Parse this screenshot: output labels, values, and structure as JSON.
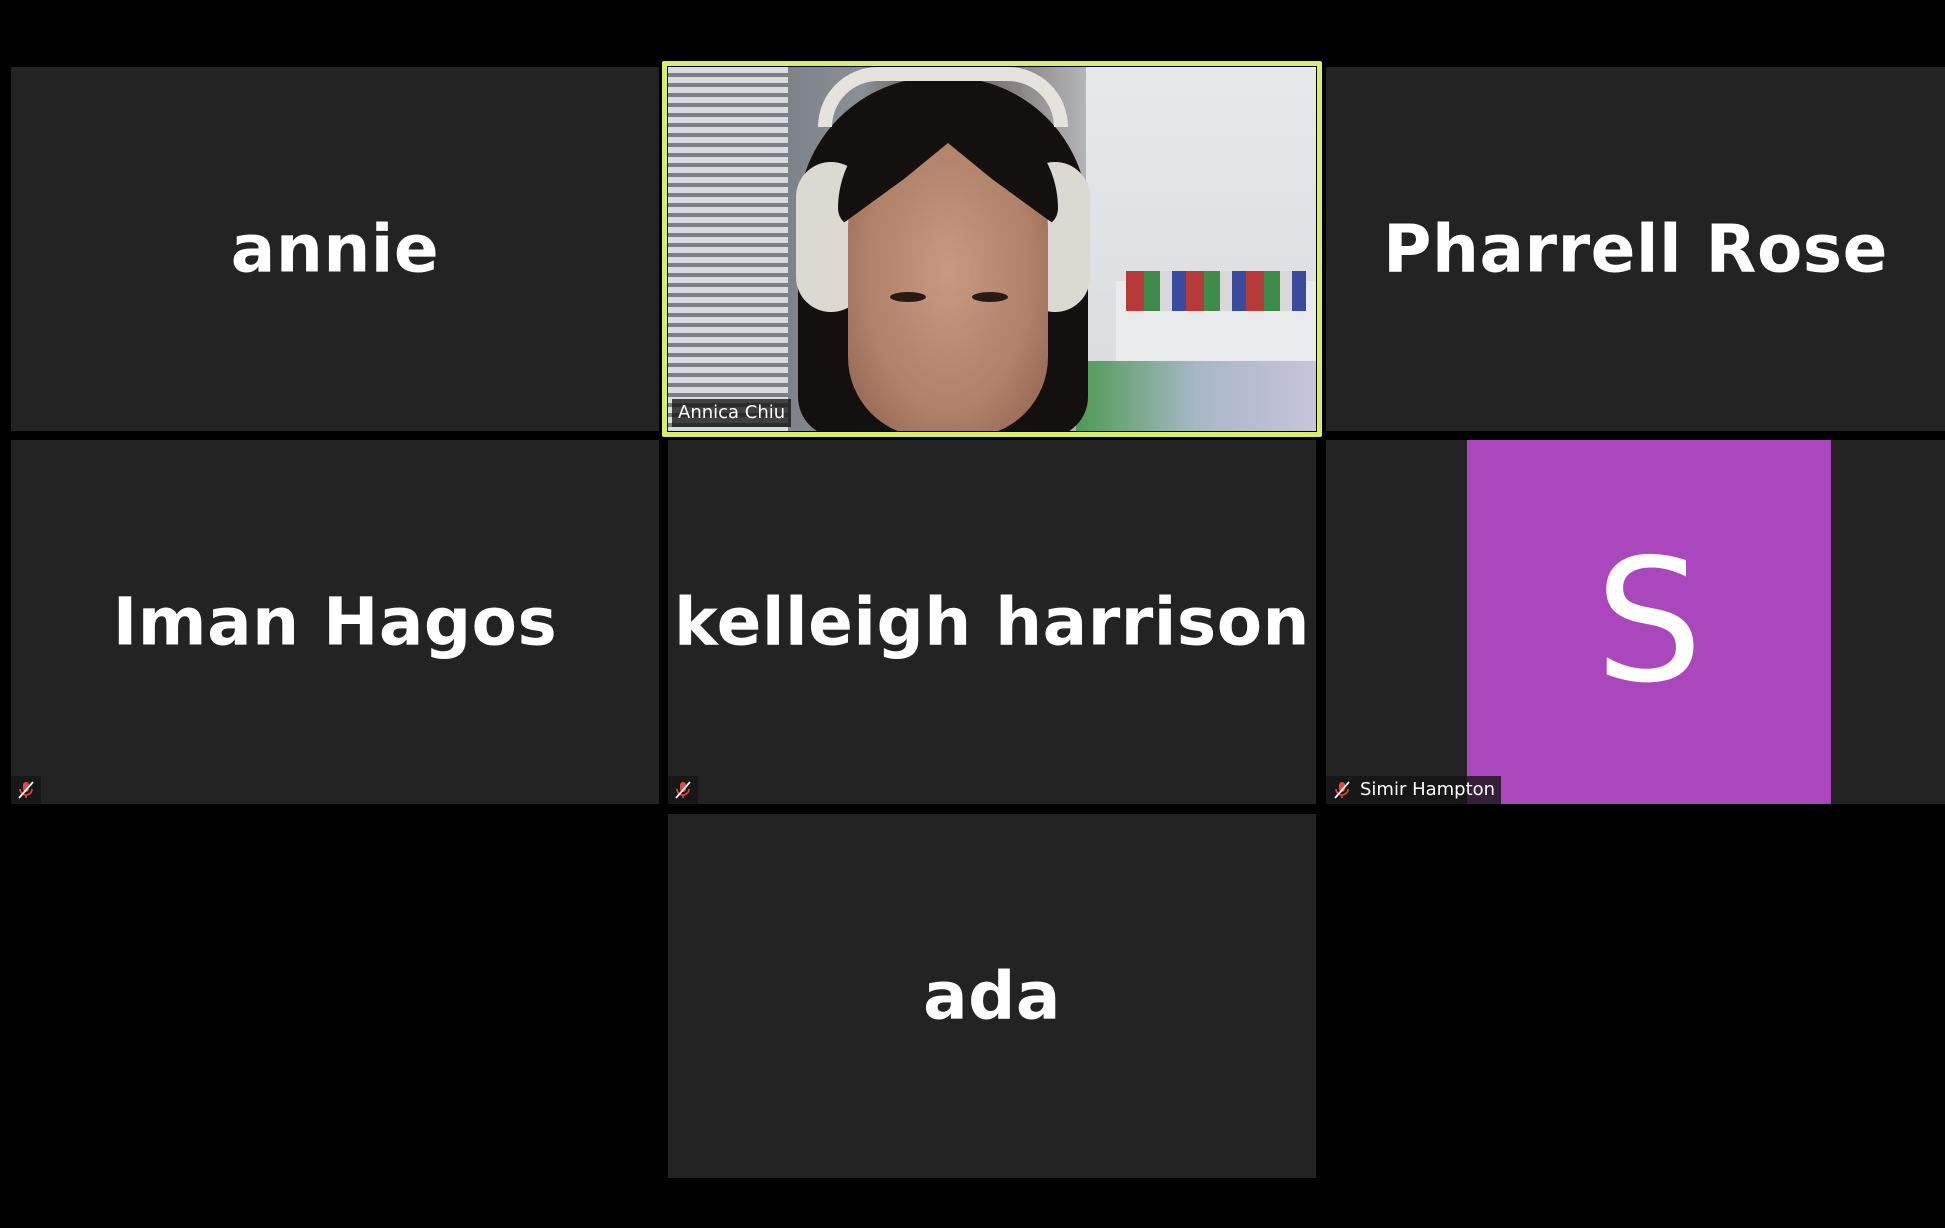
{
  "participants": [
    {
      "id": "annie",
      "display_name": "annie",
      "video": false,
      "muted": false
    },
    {
      "id": "annica",
      "display_name": "Annica Chiu",
      "video": true,
      "active_speaker": true,
      "muted": false
    },
    {
      "id": "pharrell",
      "display_name": "Pharrell Rose",
      "video": false,
      "muted": false
    },
    {
      "id": "iman",
      "display_name": "Iman Hagos",
      "video": false,
      "muted": true
    },
    {
      "id": "kelleigh",
      "display_name": "kelleigh harrison",
      "video": false,
      "muted": true
    },
    {
      "id": "simir",
      "display_name": "Simir Hampton",
      "video": false,
      "muted": true,
      "avatar_letter": "S"
    },
    {
      "id": "ada",
      "display_name": "ada",
      "video": false,
      "muted": false
    }
  ],
  "colors": {
    "background": "#000000",
    "tile": "#232323",
    "active_speaker_border": "#d6ee6a",
    "avatar_purple": "#ab47bc",
    "muted_red": "#e8453c"
  },
  "icons": {
    "muted": "microphone-muted-icon"
  }
}
